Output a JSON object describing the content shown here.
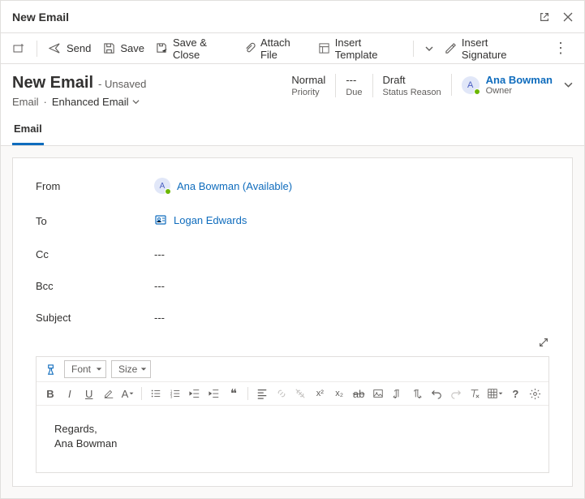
{
  "titlebar": {
    "title": "New Email"
  },
  "toolbar": {
    "send": "Send",
    "save": "Save",
    "save_close": "Save & Close",
    "attach": "Attach File",
    "insert_template": "Insert Template",
    "insert_signature": "Insert Signature"
  },
  "header": {
    "title": "New Email",
    "unsaved": "- Unsaved",
    "breadcrumb1": "Email",
    "breadcrumb_sep": "·",
    "breadcrumb2": "Enhanced Email",
    "meta": [
      {
        "value": "Normal",
        "label": "Priority"
      },
      {
        "value": "---",
        "label": "Due"
      },
      {
        "value": "Draft",
        "label": "Status Reason"
      }
    ],
    "owner": {
      "initial": "A",
      "name": "Ana Bowman",
      "role": "Owner"
    }
  },
  "tabs": {
    "email": "Email"
  },
  "form": {
    "from_label": "From",
    "from_initial": "A",
    "from_name": "Ana Bowman (Available)",
    "to_label": "To",
    "to_name": "Logan Edwards",
    "cc_label": "Cc",
    "cc_value": "---",
    "bcc_label": "Bcc",
    "bcc_value": "---",
    "subject_label": "Subject",
    "subject_value": "---"
  },
  "editor": {
    "font_label": "Font",
    "size_label": "Size",
    "body_line1": "Regards,",
    "body_line2": "Ana Bowman"
  }
}
